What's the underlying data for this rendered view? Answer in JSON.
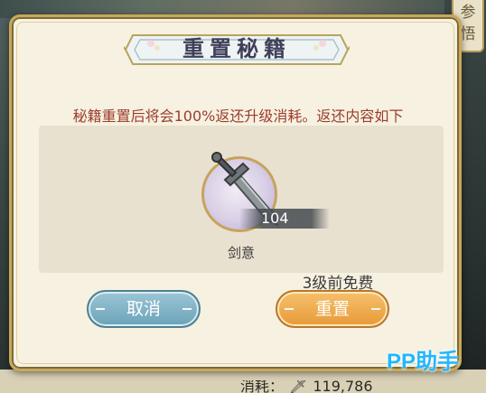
{
  "background": {
    "side_plaque_text": "参\n悟",
    "bottom_cost_label": "消耗：",
    "bottom_cost_value": "119,786"
  },
  "dialog": {
    "title": "重置秘籍",
    "description": "秘籍重置后将会100%返还升级消耗。返还内容如下",
    "reward": {
      "icon": "sword-icon",
      "quantity": "104",
      "name": "剑意"
    },
    "free_hint": "3级前免费",
    "cancel_label": "取消",
    "reset_label": "重置"
  },
  "watermark": "PP助手",
  "colors": {
    "dialog_bg": "#f6f1e1",
    "border_gold": "#c9a858",
    "description_red": "#9c3d2d",
    "cancel_blue": "#6ba2b8",
    "reset_orange": "#e79938",
    "watermark_blue": "#22b7ff"
  }
}
